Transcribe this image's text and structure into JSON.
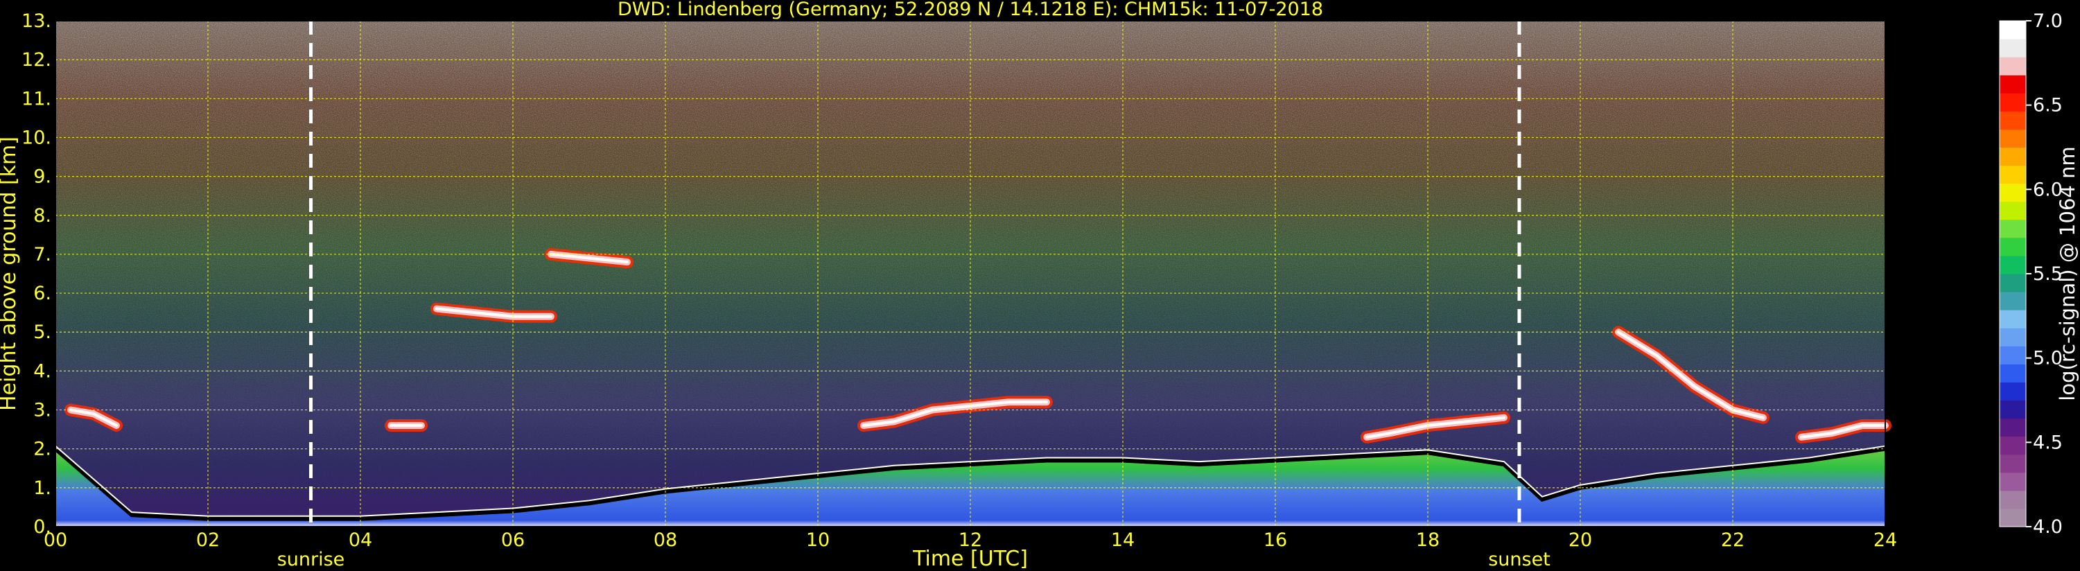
{
  "chart_data": {
    "type": "heatmap",
    "title": "DWD: Lindenberg (Germany; 52.2089 N / 14.1218 E):    CHM15k: 11-07-2018",
    "xlabel": "Time [UTC]",
    "ylabel": "Height above ground [km]",
    "xlim": [
      0,
      24
    ],
    "ylim": [
      0,
      13
    ],
    "x_ticks": [
      "00",
      "02",
      "04",
      "06",
      "08",
      "10",
      "12",
      "14",
      "16",
      "18",
      "20",
      "22",
      "24"
    ],
    "y_ticks": [
      "0.",
      "1.",
      "2.",
      "3.",
      "4.",
      "5.",
      "6.",
      "7.",
      "8.",
      "9.",
      "10.",
      "11.",
      "12.",
      "13."
    ],
    "grid": true,
    "colorbar": {
      "label": "log(rc-signal) @ 1064 nm",
      "range": [
        4.0,
        7.0
      ],
      "ticks": [
        "4.0",
        "4.5",
        "5.0",
        "5.5",
        "6.0",
        "6.5",
        "7.0"
      ],
      "colors": [
        "#a58ea5",
        "#a27fa3",
        "#9a5a9c",
        "#8a3c8c",
        "#7a2a86",
        "#5a1a86",
        "#2a1aa0",
        "#1e2fd2",
        "#2f5cf0",
        "#4f83f5",
        "#6aa2f2",
        "#7fc0f0",
        "#3fa0b0",
        "#1ea080",
        "#10c060",
        "#30d040",
        "#70e040",
        "#c0f000",
        "#f0f000",
        "#ffd000",
        "#ffaa00",
        "#ff7a00",
        "#ff4a00",
        "#ff1a00",
        "#ee0000",
        "#f4c2c2",
        "#ececec",
        "#ffffff"
      ]
    },
    "events": [
      {
        "name": "sunrise",
        "x": 3.35
      },
      {
        "name": "sunset",
        "x": 19.2
      }
    ],
    "layers": [
      {
        "name": "boundary layer top",
        "x": [
          0,
          1,
          2,
          3,
          4,
          5,
          6,
          7,
          8,
          9,
          10,
          11,
          12,
          13,
          14,
          15,
          16,
          17,
          18,
          19,
          19.5,
          20,
          21,
          22,
          23,
          24
        ],
        "y": [
          2.0,
          0.3,
          0.2,
          0.2,
          0.2,
          0.3,
          0.4,
          0.6,
          0.9,
          1.1,
          1.3,
          1.5,
          1.6,
          1.7,
          1.7,
          1.6,
          1.7,
          1.8,
          1.9,
          1.6,
          0.7,
          1.0,
          1.3,
          1.5,
          1.7,
          2.0
        ]
      },
      {
        "name": "cloud layer 1",
        "x": [
          0.2,
          0.5,
          0.8
        ],
        "y": [
          3.0,
          2.9,
          2.6
        ]
      },
      {
        "name": "cloud layer 2",
        "x": [
          10.6,
          11,
          11.5,
          12,
          12.5,
          13
        ],
        "y": [
          2.6,
          2.7,
          3.0,
          3.1,
          3.2,
          3.2
        ]
      },
      {
        "name": "cloud layer 3",
        "x": [
          17.2,
          17.5,
          18,
          18.5,
          19
        ],
        "y": [
          2.3,
          2.4,
          2.6,
          2.7,
          2.8
        ]
      },
      {
        "name": "cloud layer 4",
        "x": [
          20.5,
          21,
          21.5,
          22,
          22.4
        ],
        "y": [
          5.0,
          4.4,
          3.6,
          3.0,
          2.8
        ]
      },
      {
        "name": "cloud layer 5",
        "x": [
          22.9,
          23.3,
          23.7,
          24
        ],
        "y": [
          2.3,
          2.4,
          2.6,
          2.6
        ]
      },
      {
        "name": "cloud layer 6",
        "x": [
          5.0,
          5.5,
          6.0,
          6.5
        ],
        "y": [
          5.6,
          5.5,
          5.4,
          5.4
        ]
      },
      {
        "name": "cloud layer 7",
        "x": [
          6.5,
          7.0,
          7.5
        ],
        "y": [
          7.0,
          6.9,
          6.8
        ]
      },
      {
        "name": "cloud layer 8",
        "x": [
          4.4,
          4.8
        ],
        "y": [
          2.6,
          2.6
        ]
      }
    ]
  }
}
